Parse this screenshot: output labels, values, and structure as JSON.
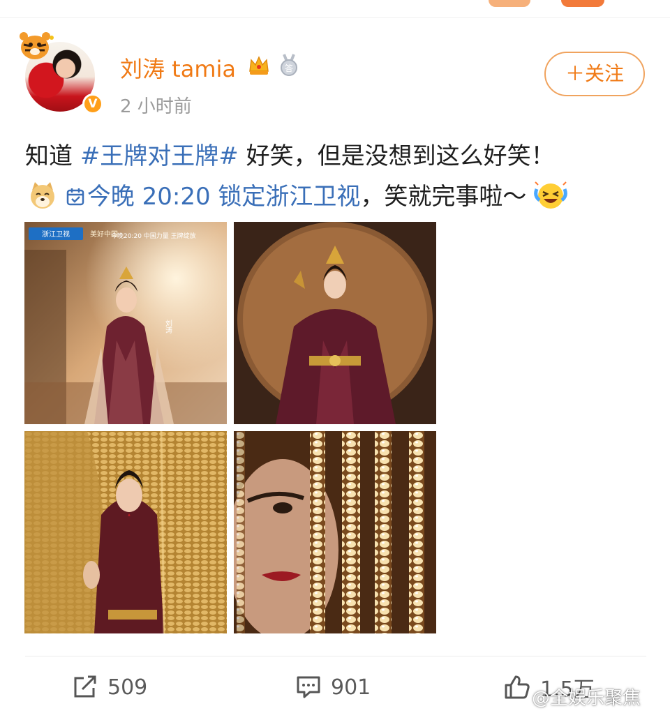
{
  "post": {
    "username": "刘涛 tamia",
    "time": "2 小时前",
    "follow_label": "＋关注",
    "verified_mark": "V",
    "text_line1": {
      "prefix": "知道 ",
      "topic": "#王牌对王牌#",
      "suffix": " 好笑，但是没想到这么好笑！"
    },
    "text_line2": {
      "link": "今晚 20:20 锁定浙江卫视",
      "suffix": "，笑就完事啦～"
    },
    "photo1_overlay": {
      "channel": "浙江卫视",
      "show": "美好中国",
      "headline": "今晚20:20  中国力量 王牌绽放",
      "name_vertical": "刘涛"
    }
  },
  "actions": {
    "share_count": "509",
    "comment_count": "901",
    "like_count": "1.5万"
  },
  "watermark": "@全娱乐聚焦",
  "icons": {
    "verified": "verified-badge-icon",
    "crown": "crown-icon",
    "medal": "medal-icon",
    "doge": "doge-emoji-icon",
    "link": "link-icon",
    "laugh": "laugh-cry-emoji-icon",
    "share": "share-icon",
    "comment": "comment-icon",
    "like": "thumbs-up-icon"
  },
  "colors": {
    "username": "#f07a15",
    "topic": "#3a6fb8",
    "follow_border": "#f0a35e"
  }
}
